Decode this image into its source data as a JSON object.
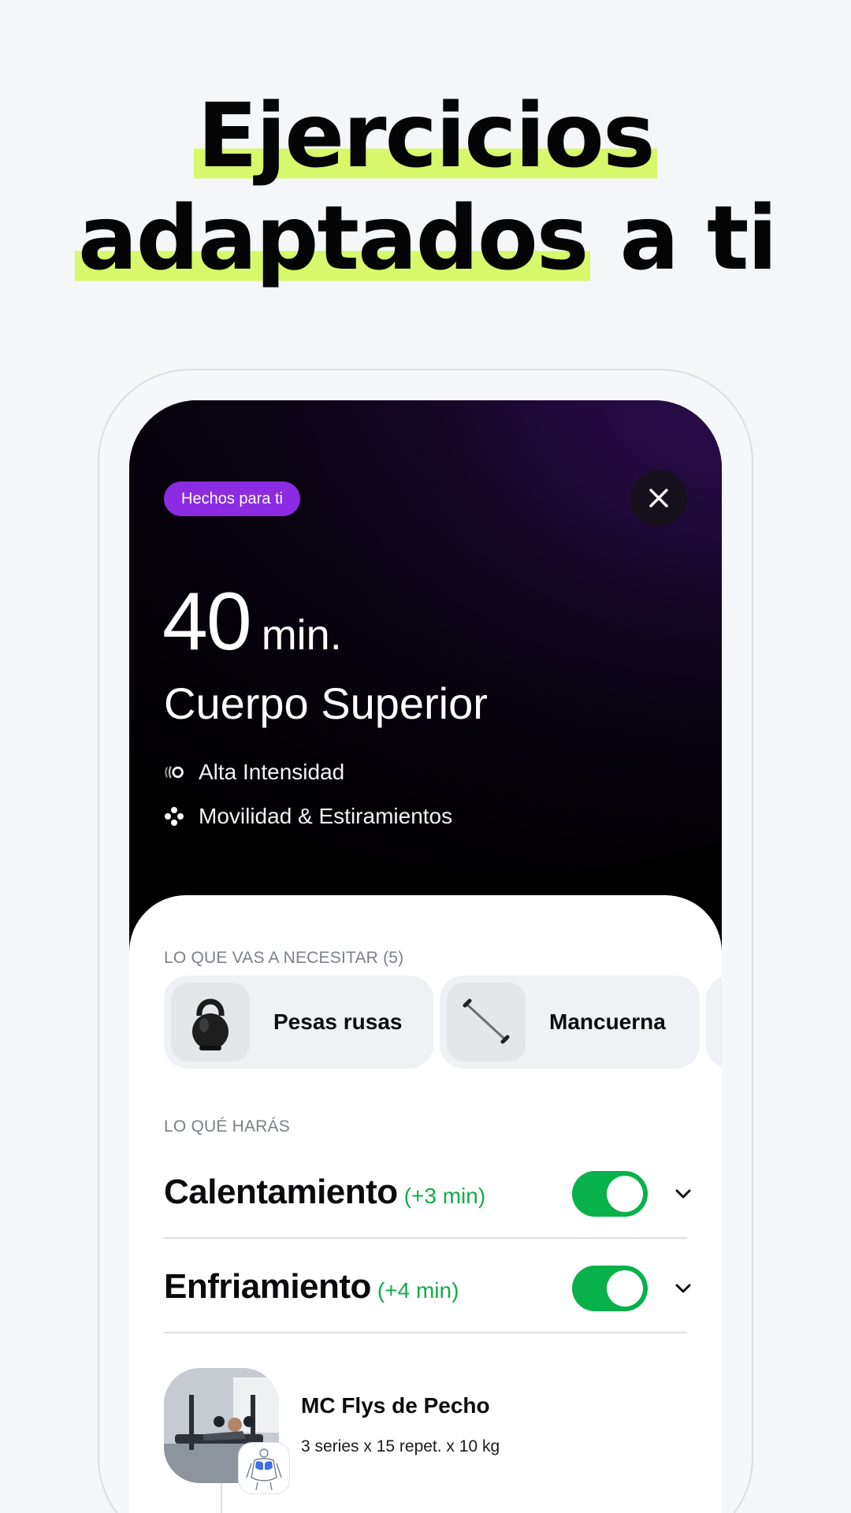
{
  "headline": {
    "line1_highlight": "Ejercicios",
    "line2_highlight": "adaptados",
    "line2_rest": " a ti",
    "highlight_color": "#d6f86a"
  },
  "hero": {
    "badge": "Hechos para ti",
    "badge_color": "#8b2be2",
    "duration_value": "40",
    "duration_unit": "min.",
    "title": "Cuerpo Superior",
    "tags": [
      {
        "icon": "intensity-icon",
        "label": "Alta Intensidad"
      },
      {
        "icon": "mobility-icon",
        "label": "Movilidad & Estiramientos"
      }
    ]
  },
  "sheet": {
    "need_label": "LO QUE VAS A NECESITAR (5)",
    "equipment": [
      {
        "icon": "kettlebell-icon",
        "name": "Pesas rusas"
      },
      {
        "icon": "barbell-icon",
        "name": "Mancuerna"
      }
    ],
    "do_label": "LO QUÉ HARÁS",
    "sections": [
      {
        "title": "Calentamiento",
        "extra": "(+3 min)",
        "enabled": true
      },
      {
        "title": "Enfriamiento",
        "extra": "(+4 min)",
        "enabled": true
      }
    ],
    "exercise": {
      "name": "MC Flys de Pecho",
      "detail": "3 series x 15 repet. x 10 kg"
    },
    "accent_green": "#08b14a"
  }
}
